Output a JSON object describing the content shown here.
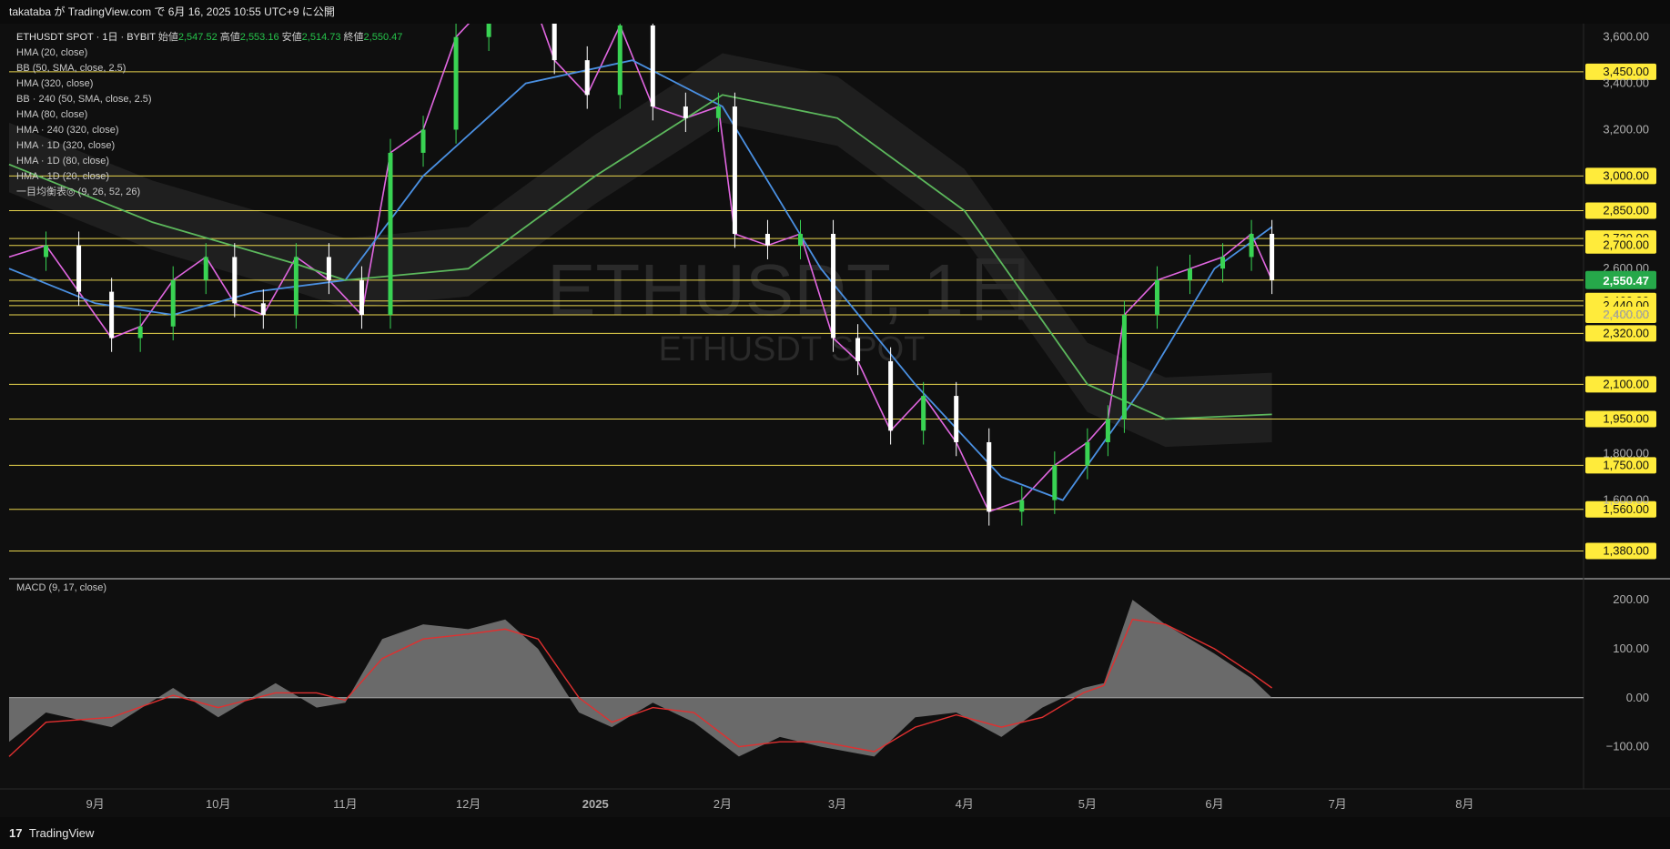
{
  "header": {
    "publish_line": "takataba が TradingView.com で 6月 16, 2025 10:55 UTC+9 に公開"
  },
  "footer": {
    "brand": "TradingView",
    "logo_glyph": "17"
  },
  "legend": {
    "symbol_line": "ETHUSDT SPOT · 1日 · BYBIT",
    "open_label": "始値",
    "open": "2,547.52",
    "high_label": "高値",
    "high": "2,553.16",
    "low_label": "安値",
    "low": "2,514.73",
    "close_label": "終値",
    "close": "2,550.47",
    "indicators": [
      "HMA (20, close)",
      "BB (50, SMA, close, 2.5)",
      "HMA (320, close)",
      "BB · 240 (50, SMA, close, 2.5)",
      "HMA (80, close)",
      "HMA · 240 (320, close)",
      "HMA · 1D (320, close)",
      "HMA · 1D (80, close)",
      "HMA · 1D (20, close)",
      "一目均衡表◎ (9, 26, 52, 26)"
    ]
  },
  "watermark": {
    "main": "ETHUSDT, 1日",
    "sub": "ETHUSDT SPOT"
  },
  "colors": {
    "background": "#0f0f0f",
    "candle_up": "#39d353",
    "candle_down": "#ffffff",
    "hma20": "#e066e0",
    "hma80": "#4a90e2",
    "hma320": "#5cb85c",
    "bollinger": "#3d7fd6",
    "ichimoku_cloud": "#2a2a2a",
    "level_line": "#e8d44d",
    "level_label_bg": "#ffeb3b",
    "macd_line": "#e03030",
    "macd_area": "#7a7a7a",
    "last_price_bg": "#26a84a"
  },
  "macd_label": "MACD (9, 17, close)",
  "chart_data": [
    {
      "type": "line",
      "title": "ETHUSDT SPOT · 1日 · BYBIT",
      "x_tick_labels": [
        "9月",
        "10月",
        "11月",
        "12月",
        "2025",
        "2月",
        "3月",
        "4月",
        "5月",
        "6月",
        "7月",
        "8月"
      ],
      "x_tick_dates": [
        "2024-09-01",
        "2024-10-01",
        "2024-11-01",
        "2024-12-01",
        "2025-01-01",
        "2025-02-01",
        "2025-03-01",
        "2025-04-01",
        "2025-05-01",
        "2025-06-01",
        "2025-07-01",
        "2025-08-01"
      ],
      "x_range": [
        "2024-08-11",
        "2025-08-30"
      ],
      "ylim": [
        1280,
        3650
      ],
      "y_ticks": [
        3600,
        3400,
        3200,
        2600,
        2400,
        1800,
        1600
      ],
      "price_levels": [
        3450,
        3000,
        2850,
        2730,
        2700,
        2550,
        2460,
        2440,
        2400,
        2320,
        2100,
        1950,
        1750,
        1560,
        1380
      ],
      "last_price": 2550.47,
      "series": [
        {
          "x": [
            "2024-08-11",
            "2024-08-20",
            "2024-08-28",
            "2024-09-05",
            "2024-09-12",
            "2024-09-20",
            "2024-09-28",
            "2024-10-05",
            "2024-10-12",
            "2024-10-20",
            "2024-10-28",
            "2024-11-05",
            "2024-11-12",
            "2024-11-20",
            "2024-11-28",
            "2024-12-06",
            "2024-12-14",
            "2024-12-22",
            "2024-12-30",
            "2025-01-07",
            "2025-01-15",
            "2025-01-23",
            "2025-01-31",
            "2025-02-04",
            "2025-02-12",
            "2025-02-20",
            "2025-02-28",
            "2025-03-06",
            "2025-03-14",
            "2025-03-22",
            "2025-03-30",
            "2025-04-07",
            "2025-04-15",
            "2025-04-23",
            "2025-05-01",
            "2025-05-06",
            "2025-05-10",
            "2025-05-18",
            "2025-05-26",
            "2025-06-03",
            "2025-06-10",
            "2025-06-15"
          ],
          "values": [
            2650,
            2700,
            2500,
            2300,
            2350,
            2550,
            2650,
            2450,
            2400,
            2650,
            2550,
            2400,
            3100,
            3200,
            3600,
            3750,
            3900,
            3500,
            3350,
            3650,
            3300,
            3250,
            3300,
            2750,
            2700,
            2750,
            2300,
            2200,
            1900,
            2050,
            1850,
            1550,
            1600,
            1750,
            1850,
            1950,
            2400,
            2550,
            2600,
            2650,
            2750,
            2550
          ]
        },
        {
          "x": [
            "2024-08-11",
            "2024-09-01",
            "2024-09-20",
            "2024-10-10",
            "2024-11-01",
            "2024-11-20",
            "2024-12-15",
            "2025-01-10",
            "2025-02-01",
            "2025-02-25",
            "2025-03-20",
            "2025-04-10",
            "2025-04-25",
            "2025-05-15",
            "2025-06-01",
            "2025-06-15"
          ],
          "values": [
            2600,
            2450,
            2400,
            2500,
            2550,
            3000,
            3400,
            3500,
            3300,
            2600,
            2100,
            1700,
            1600,
            2100,
            2600,
            2780
          ]
        },
        {
          "x": [
            "2024-08-11",
            "2024-09-15",
            "2024-10-20",
            "2024-11-01",
            "2024-12-01",
            "2025-01-01",
            "2025-02-01",
            "2025-03-01",
            "2025-04-01",
            "2025-05-01",
            "2025-05-20",
            "2025-06-15"
          ],
          "values": [
            3050,
            2800,
            2620,
            2550,
            2600,
            3000,
            3350,
            3250,
            2850,
            2100,
            1950,
            1970
          ]
        }
      ]
    },
    {
      "type": "area",
      "title": "MACD (9, 17, close)",
      "ylim": [
        -175,
        230
      ],
      "y_ticks": [
        200,
        100,
        0,
        -100
      ],
      "x": [
        "2024-08-11",
        "2024-08-20",
        "2024-09-05",
        "2024-09-20",
        "2024-10-01",
        "2024-10-15",
        "2024-10-25",
        "2024-11-01",
        "2024-11-10",
        "2024-11-20",
        "2024-12-01",
        "2024-12-10",
        "2024-12-18",
        "2024-12-28",
        "2025-01-05",
        "2025-01-15",
        "2025-01-25",
        "2025-02-05",
        "2025-02-15",
        "2025-02-25",
        "2025-03-10",
        "2025-03-20",
        "2025-03-30",
        "2025-04-10",
        "2025-04-20",
        "2025-04-30",
        "2025-05-05",
        "2025-05-12",
        "2025-05-20",
        "2025-06-01",
        "2025-06-10",
        "2025-06-15"
      ],
      "series": [
        {
          "values": [
            -90,
            -30,
            -60,
            20,
            -40,
            30,
            -20,
            -10,
            120,
            150,
            140,
            160,
            100,
            -30,
            -60,
            -10,
            -50,
            -120,
            -80,
            -100,
            -120,
            -40,
            -30,
            -80,
            -20,
            20,
            30,
            200,
            150,
            90,
            40,
            0
          ]
        },
        {
          "values": [
            -120,
            -50,
            -40,
            5,
            -20,
            10,
            10,
            -5,
            80,
            120,
            130,
            140,
            120,
            0,
            -50,
            -20,
            -30,
            -100,
            -90,
            -90,
            -110,
            -60,
            -35,
            -60,
            -40,
            10,
            25,
            160,
            150,
            100,
            50,
            20
          ]
        }
      ]
    }
  ]
}
